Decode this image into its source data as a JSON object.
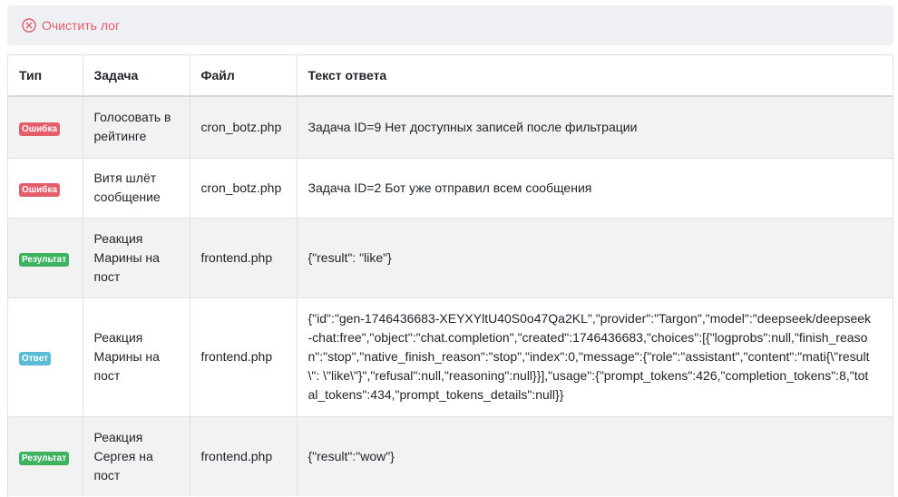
{
  "toolbar": {
    "clear_label": "Очистить лог",
    "clear_icon": "circle-x-icon",
    "accent": "#e35d6a"
  },
  "table": {
    "headers": {
      "type": "Тип",
      "task": "Задача",
      "file": "Файл",
      "answer": "Текст ответа"
    },
    "rows": [
      {
        "type": "Ошибка",
        "type_color": "#e35d6a",
        "task": "Голосовать в рейтинге",
        "file": "cron_botz.php",
        "answer": "Задача ID=9 Нет доступных записей после фильтрации"
      },
      {
        "type": "Ошибка",
        "type_color": "#e35d6a",
        "task": "Витя шлёт сообщение",
        "file": "cron_botz.php",
        "answer": "Задача ID=2 Бот уже отправил всем сообщения"
      },
      {
        "type": "Результат",
        "type_color": "#3eb35f",
        "task": "Реакция Марины на пост",
        "file": "frontend.php",
        "answer": "{\"result\": \"like\"}"
      },
      {
        "type": "Ответ",
        "type_color": "#5bbcd6",
        "task": "Реакция Марины на пост",
        "file": "frontend.php",
        "answer": "{\"id\":\"gen-1746436683-XEYXYltU40S0o47Qa2KL\",\"provider\":\"Targon\",\"model\":\"deepseek/deepseek-chat:free\",\"object\":\"chat.completion\",\"created\":1746436683,\"choices\":[{\"logprobs\":null,\"finish_reason\":\"stop\",\"native_finish_reason\":\"stop\",\"index\":0,\"message\":{\"role\":\"assistant\",\"content\":\"mati{\\\"result\\\": \\\"like\\\"}\",\"refusal\":null,\"reasoning\":null}}],\"usage\":{\"prompt_tokens\":426,\"completion_tokens\":8,\"total_tokens\":434,\"prompt_tokens_details\":null}}"
      },
      {
        "type": "Результат",
        "type_color": "#3eb35f",
        "task": "Реакция Сергея на пост",
        "file": "frontend.php",
        "answer": "{\"result\":\"wow\"}"
      }
    ]
  }
}
